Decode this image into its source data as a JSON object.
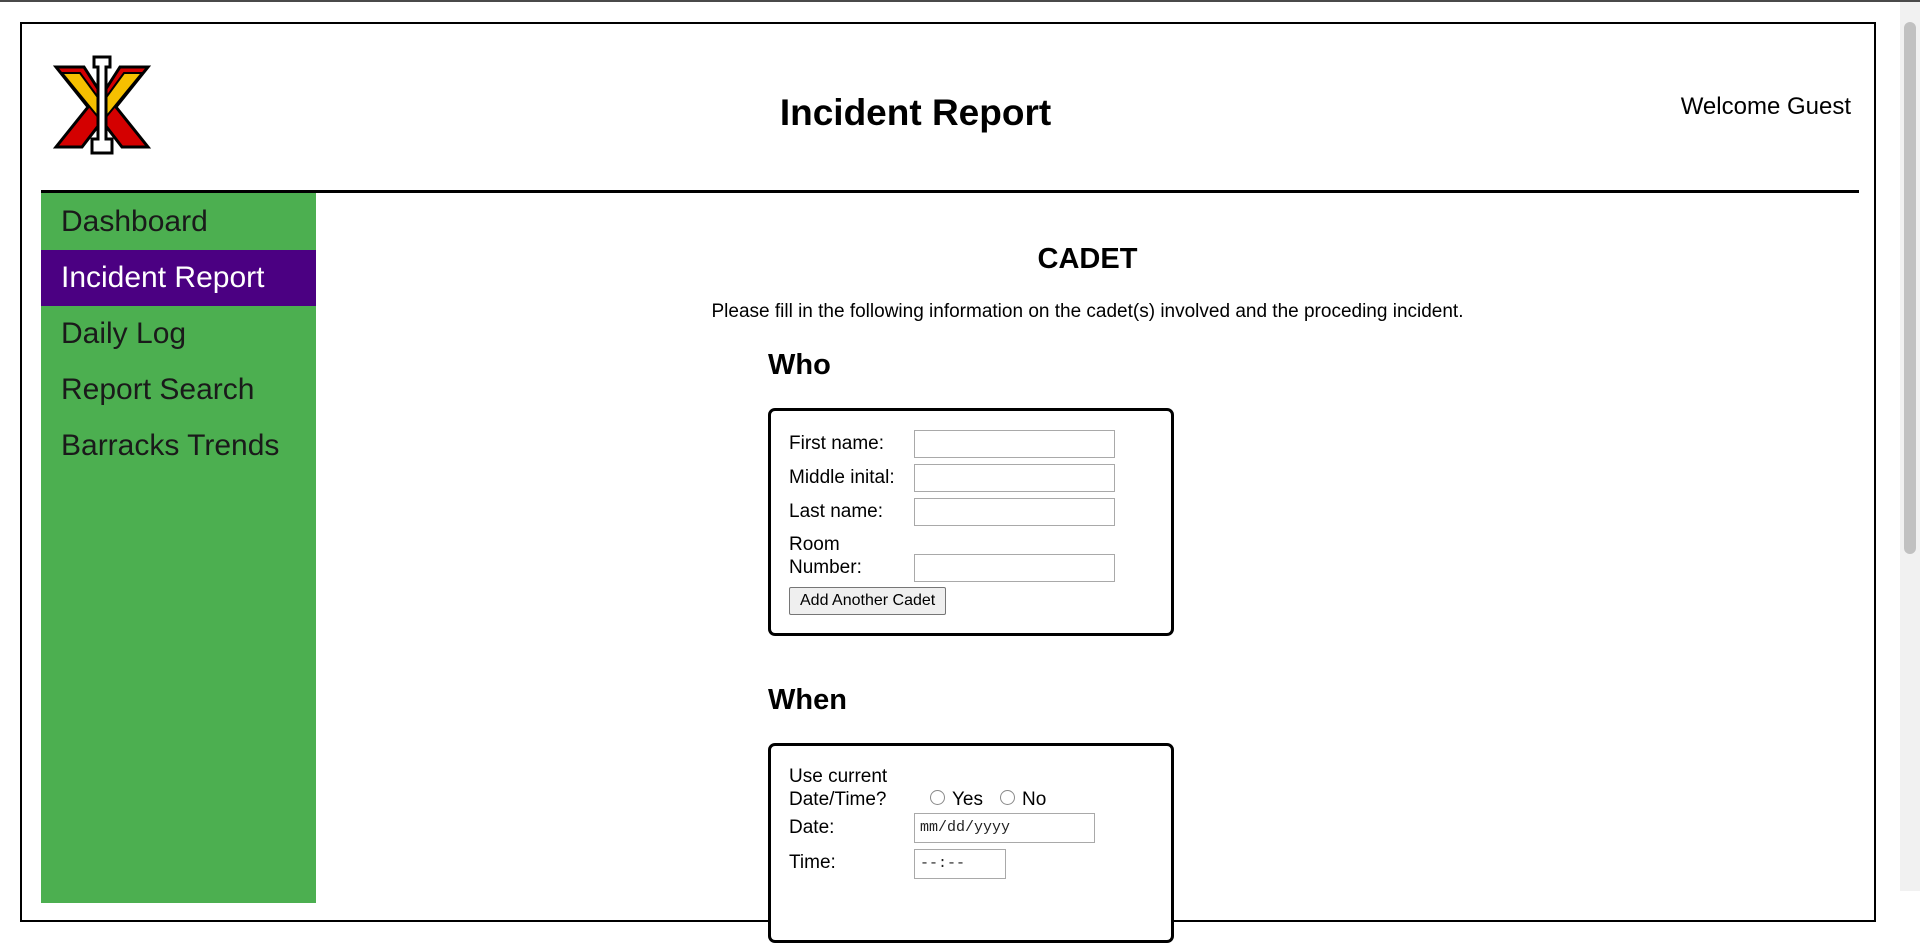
{
  "header": {
    "title": "Incident Report",
    "welcome": "Welcome Guest"
  },
  "sidebar": {
    "items": [
      {
        "label": "Dashboard",
        "active": false
      },
      {
        "label": "Incident Report",
        "active": true
      },
      {
        "label": "Daily Log",
        "active": false
      },
      {
        "label": "Report Search",
        "active": false
      },
      {
        "label": "Barracks Trends",
        "active": false
      }
    ]
  },
  "main": {
    "section_title": "CADET",
    "intro": "Please fill in the following information on the cadet(s) involved and the proceding incident.",
    "who": {
      "heading": "Who",
      "first_name_label": "First name:",
      "first_name_value": "",
      "middle_initial_label": "Middle inital:",
      "middle_initial_value": "",
      "last_name_label": "Last name:",
      "last_name_value": "",
      "room_label_line1": "Room",
      "room_label_line2": "Number:",
      "room_value": "",
      "add_button": "Add Another Cadet"
    },
    "when": {
      "heading": "When",
      "use_current_line1": "Use current",
      "use_current_line2": "Date/Time?",
      "yes_label": "Yes",
      "no_label": "No",
      "date_label": "Date:",
      "date_placeholder": "mm/dd/yyyy",
      "time_label": "Time:",
      "time_placeholder": "--:--"
    }
  },
  "colors": {
    "sidebar_bg": "#4caf50",
    "sidebar_active_bg": "#4b0082",
    "logo_red": "#d40000",
    "logo_yellow": "#f5c000"
  },
  "icons": {
    "logo": "vmi-logo"
  }
}
